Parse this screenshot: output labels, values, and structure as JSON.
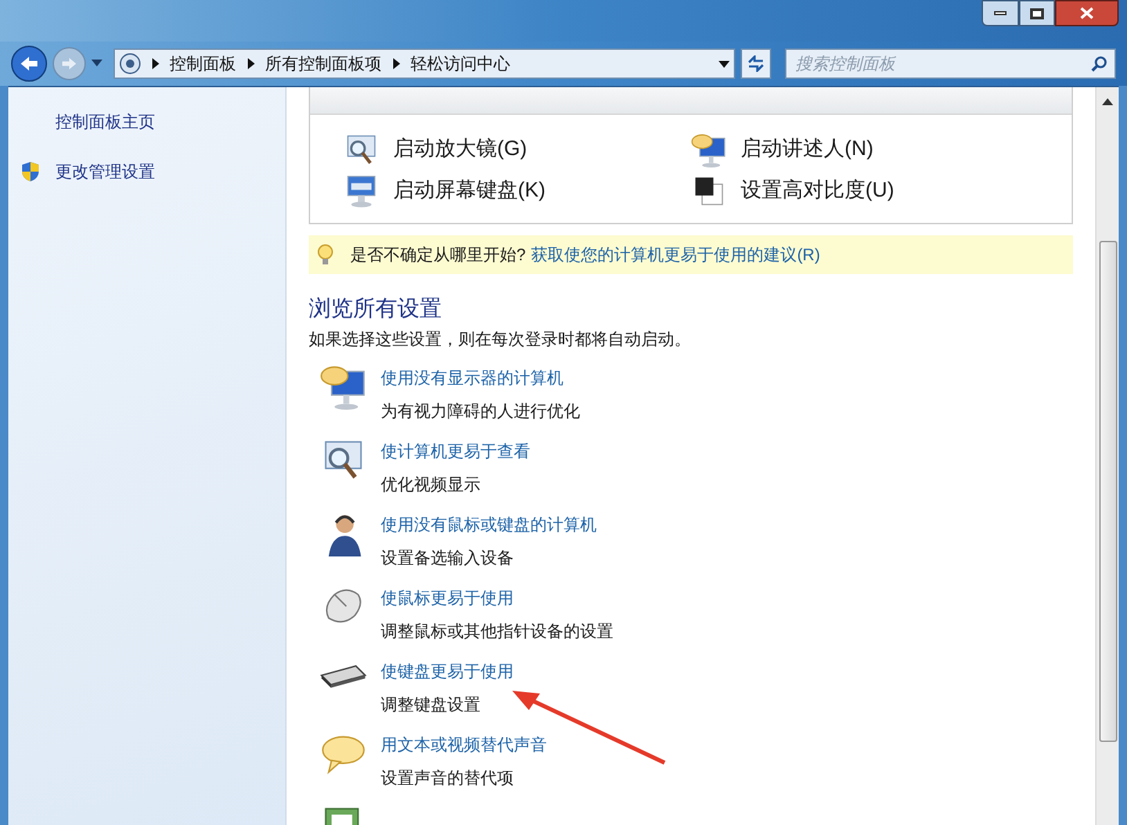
{
  "address_bar": {
    "crumbs": [
      "控制面板",
      "所有控制面板项",
      "轻松访问中心"
    ]
  },
  "search": {
    "placeholder": "搜索控制面板"
  },
  "sidebar": {
    "items": [
      {
        "label": "控制面板主页",
        "kind": "plain"
      },
      {
        "label": "更改管理设置",
        "kind": "shield"
      }
    ]
  },
  "quick_access": [
    {
      "label": "启动放大镜(G)",
      "kind": "magnifier"
    },
    {
      "label": "启动讲述人(N)",
      "kind": "narrator"
    },
    {
      "label": "启动屏幕键盘(K)",
      "kind": "osk"
    },
    {
      "label": "设置高对比度(U)",
      "kind": "contrast"
    }
  ],
  "tip": {
    "question": "是否不确定从哪里开始?",
    "link": "获取使您的计算机更易于使用的建议(R)"
  },
  "browse": {
    "heading": "浏览所有设置",
    "description": "如果选择这些设置，则在每次登录时都将自动启动。"
  },
  "settings": [
    {
      "title": "使用没有显示器的计算机",
      "description": "为有视力障碍的人进行优化",
      "kind": "narrator"
    },
    {
      "title": "使计算机更易于查看",
      "description": "优化视频显示",
      "kind": "magnifier"
    },
    {
      "title": "使用没有鼠标或键盘的计算机",
      "description": "设置备选输入设备",
      "kind": "person"
    },
    {
      "title": "使鼠标更易于使用",
      "description": "调整鼠标或其他指针设备的设置",
      "kind": "mouse"
    },
    {
      "title": "使键盘更易于使用",
      "description": "调整键盘设置",
      "kind": "keyboard"
    },
    {
      "title": "用文本或视频替代声音",
      "description": "设置声音的替代项",
      "kind": "bubble"
    },
    {
      "kind": "tasks"
    }
  ]
}
